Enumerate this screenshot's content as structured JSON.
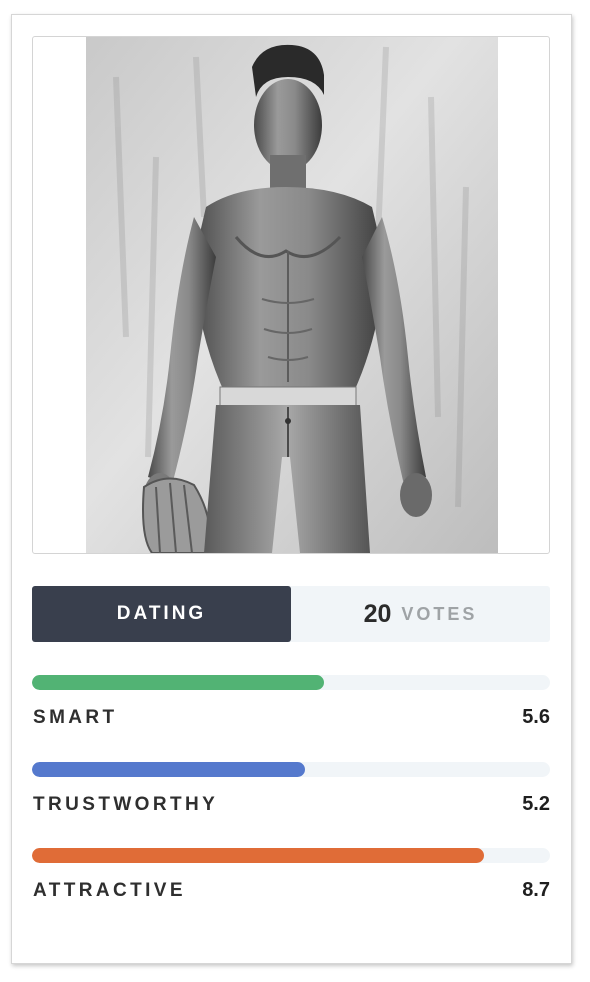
{
  "profile": {
    "photo_alt": "Shirtless man in jeans holding a striped hat"
  },
  "vote_bar": {
    "dating_label": "DATING",
    "votes_count": "20",
    "votes_label": "VOTES"
  },
  "metrics": [
    {
      "label": "SMART",
      "value": "5.6",
      "fraction": 0.563,
      "color": "#52b374"
    },
    {
      "label": "TRUSTWORTHY",
      "value": "5.2",
      "fraction": 0.527,
      "color": "#5579cd"
    },
    {
      "label": "ATTRACTIVE",
      "value": "8.7",
      "fraction": 0.873,
      "color": "#e06c37"
    }
  ],
  "colors": {
    "dating_button_bg": "#393f4d",
    "track_bg": "#f1f5f8"
  }
}
